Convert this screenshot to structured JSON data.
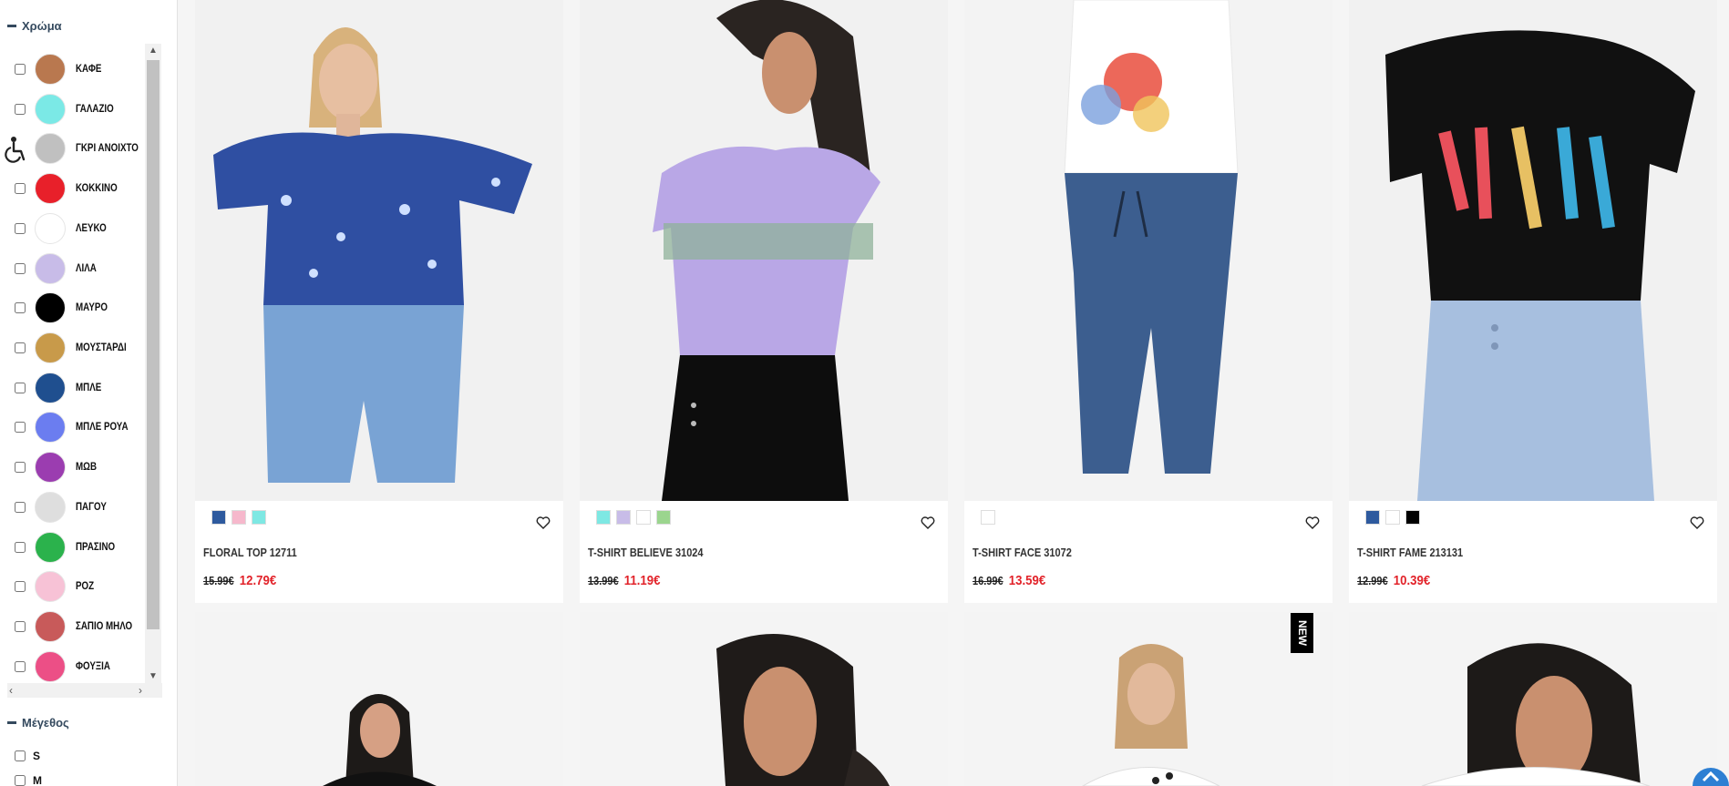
{
  "filters": {
    "color_heading": "Χρώμα",
    "size_heading": "Μέγεθος",
    "colors": [
      {
        "label": "ΚΑΦΕ",
        "hex": "#b9784f"
      },
      {
        "label": "ΓΑΛΑΖΙΟ",
        "hex": "#7be9e6"
      },
      {
        "label": "ΓΚΡΙ ΑΝΟΙΧΤΟ",
        "hex": "#c0c0c0"
      },
      {
        "label": "ΚΟΚΚΙΝΟ",
        "hex": "#e8202a"
      },
      {
        "label": "ΛΕΥΚΟ",
        "hex": "#ffffff"
      },
      {
        "label": "ΛΙΛΑ",
        "hex": "#c8bce8"
      },
      {
        "label": "ΜΑΥΡΟ",
        "hex": "#000000"
      },
      {
        "label": "ΜΟΥΣΤΑΡΔΙ",
        "hex": "#c89a4a"
      },
      {
        "label": "ΜΠΛΕ",
        "hex": "#1f4f8f"
      },
      {
        "label": "ΜΠΛΕ ΡΟΥΑ",
        "hex": "#6b7df0"
      },
      {
        "label": "ΜΩΒ",
        "hex": "#9b3db0"
      },
      {
        "label": "ΠΑΓΟΥ",
        "hex": "#dedede"
      },
      {
        "label": "ΠΡΑΣΙΝΟ",
        "hex": "#2bb24c"
      },
      {
        "label": "ΡΟΖ",
        "hex": "#f7c2d6"
      },
      {
        "label": "ΣΑΠΙΟ ΜΗΛΟ",
        "hex": "#c85a5a"
      },
      {
        "label": "ΦΟΥΞΙΑ",
        "hex": "#ec4f86"
      }
    ],
    "sizes": [
      "S",
      "M"
    ]
  },
  "products": [
    {
      "title": "FLORAL TOP 12711",
      "old_price": "15.99€",
      "new_price": "12.79€",
      "variants": [
        "#2e5a9e",
        "#f6b8cc",
        "#7ee8e3"
      ]
    },
    {
      "title": "T-SHIRT BELIEVE 31024",
      "old_price": "13.99€",
      "new_price": "11.19€",
      "variants": [
        "#7ee8e3",
        "#c8bce8",
        "#ffffff",
        "#9bd58e"
      ]
    },
    {
      "title": "T-SHIRT FACE 31072",
      "old_price": "16.99€",
      "new_price": "13.59€",
      "variants": [
        "#ffffff"
      ]
    },
    {
      "title": "T-SHIRT FAME 213131",
      "old_price": "12.99€",
      "new_price": "10.39€",
      "variants": [
        "#2e5a9e",
        "#ffffff",
        "#000000"
      ]
    }
  ],
  "second_row": {
    "new_badge": "NEW"
  }
}
